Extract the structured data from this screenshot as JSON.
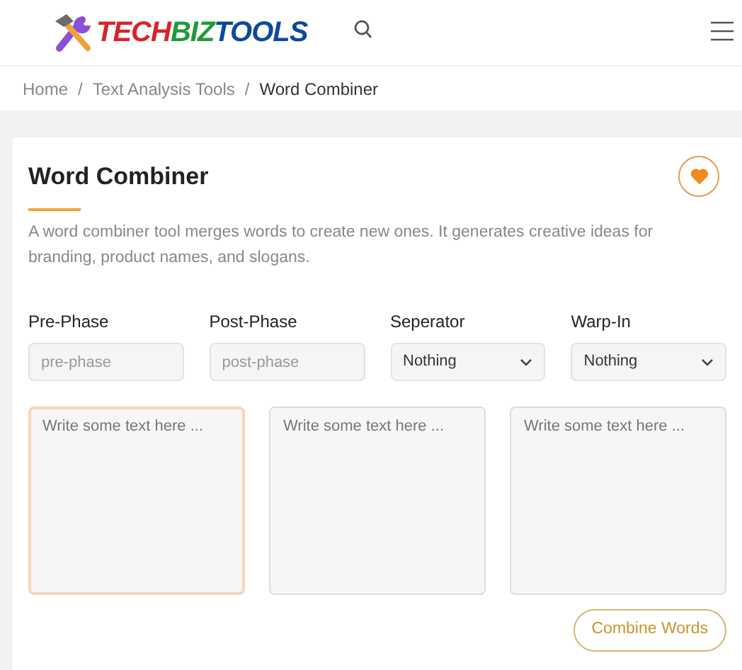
{
  "header": {
    "logo": [
      {
        "text": "TECH",
        "color": "#d8232a"
      },
      {
        "text": "BIZ",
        "color": "#1f9a3a"
      },
      {
        "text": "TOOLS",
        "color": "#0b4a9c"
      }
    ]
  },
  "breadcrumb": [
    {
      "label": "Home",
      "current": false
    },
    {
      "label": "Text Analysis Tools",
      "current": false
    },
    {
      "label": "Word Combiner",
      "current": true
    }
  ],
  "separator": "/",
  "card": {
    "title": "Word Combiner",
    "favorite": true,
    "description": "A word combiner tool merges words to create new ones. It generates creative ideas for branding, product names, and slogans.",
    "fields": [
      {
        "kind": "text",
        "label": "Pre-Phase",
        "placeholder": "pre-phase"
      },
      {
        "kind": "text",
        "label": "Post-Phase",
        "placeholder": "post-phase"
      },
      {
        "kind": "select",
        "label": "Seperator",
        "value": "Nothing"
      },
      {
        "kind": "select",
        "label": "Warp-In",
        "value": "Nothing"
      }
    ],
    "text_areas": [
      {
        "placeholder": "Write some text here ...",
        "focused": true
      },
      {
        "placeholder": "Write some text here ...",
        "focused": false
      },
      {
        "placeholder": "Write some text here ...",
        "focused": false
      }
    ],
    "button": "Combine Words"
  }
}
